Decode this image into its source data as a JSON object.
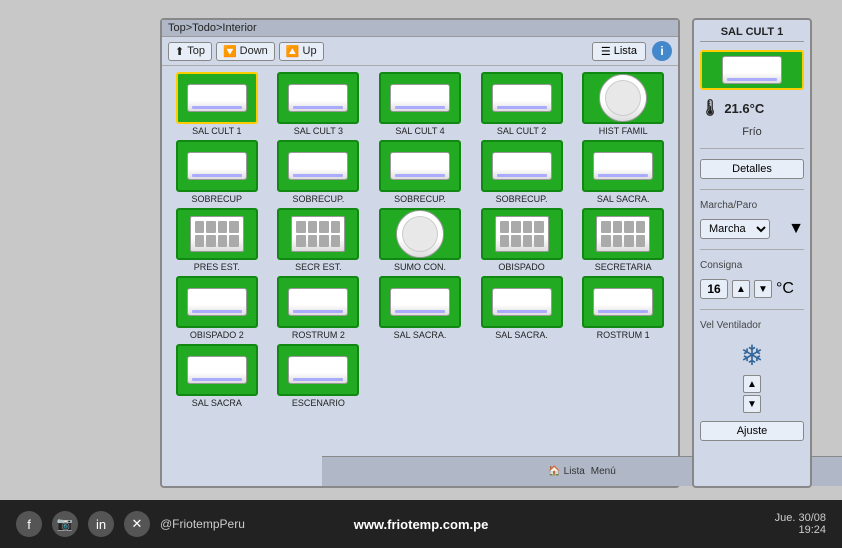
{
  "breadcrumb": "Top>Todo>Interior",
  "toolbar": {
    "top_label": "Top",
    "down_label": "Down",
    "up_label": "Up",
    "lista_label": "Lista",
    "info_label": "i"
  },
  "devices": [
    {
      "label": "SAL CULT 1",
      "type": "wall",
      "selected": true
    },
    {
      "label": "SAL CULT 3",
      "type": "wall",
      "selected": false
    },
    {
      "label": "SAL CULT 4",
      "type": "wall",
      "selected": false
    },
    {
      "label": "SAL CULT 2",
      "type": "wall",
      "selected": false
    },
    {
      "label": "HIST FAMIL",
      "type": "ceiling",
      "selected": false
    },
    {
      "label": "SOBRECUP",
      "type": "wall",
      "selected": false
    },
    {
      "label": "SOBRECUP.",
      "type": "wall",
      "selected": false
    },
    {
      "label": "SOBRECUP.",
      "type": "wall",
      "selected": false
    },
    {
      "label": "SOBRECUP.",
      "type": "wall",
      "selected": false
    },
    {
      "label": "SAL SACRA.",
      "type": "wall",
      "selected": false
    },
    {
      "label": "PRES EST.",
      "type": "grid",
      "selected": false
    },
    {
      "label": "SECR EST.",
      "type": "grid",
      "selected": false
    },
    {
      "label": "SUMO CON.",
      "type": "ceiling",
      "selected": false
    },
    {
      "label": "OBISPADO",
      "type": "grid",
      "selected": false
    },
    {
      "label": "SECRETARIA",
      "type": "grid",
      "selected": false
    },
    {
      "label": "OBISPADO 2",
      "type": "wall",
      "selected": false
    },
    {
      "label": "ROSTRUM 2",
      "type": "wall",
      "selected": false
    },
    {
      "label": "SAL SACRA.",
      "type": "wall",
      "selected": false
    },
    {
      "label": "SAL SACRA.",
      "type": "wall",
      "selected": false
    },
    {
      "label": "ROSTRUM 1",
      "type": "wall",
      "selected": false
    },
    {
      "label": "SAL SACRA",
      "type": "wall",
      "selected": false
    },
    {
      "label": "ESCENARIO",
      "type": "wall",
      "selected": false
    }
  ],
  "bottom_bar": {
    "lista_label": "Lista",
    "menu_label": "Menú"
  },
  "right_panel": {
    "title": "SAL CULT 1",
    "temperature": "21.6°C",
    "status": "Frío",
    "detalles_btn": "Detalles",
    "marcha_paro_label": "Marcha/Paro",
    "marcha_option": "Marcha",
    "consigna_label": "Consigna",
    "consigna_value": "16",
    "consigna_unit": "°C",
    "vel_label": "Vel Ventilador",
    "ajuste_btn": "Ajuste"
  },
  "social": {
    "handle": "@FriotempPeru",
    "website": "www.friotemp.com.pe",
    "datetime": "Jue. 30/08\n19:24"
  }
}
